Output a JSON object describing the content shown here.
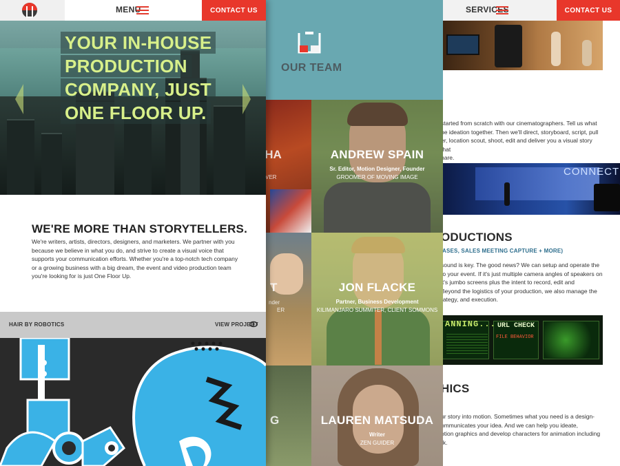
{
  "left": {
    "menu_label": "MENU",
    "contact_label": "CONTACT US",
    "hero_lines": [
      "YOUR IN-HOUSE",
      "PRODUCTION",
      "COMPANY, JUST",
      "ONE FLOOR UP."
    ],
    "about_title": "WE'RE MORE THAN STORYTELLERS.",
    "about_text": "We're writers, artists, directors, designers, and marketers. We partner with you because we believe in what you do, and strive to create a visual voice that supports your communication efforts. Whether you're a top-notch tech company or a growing business with a big dream, the event and video production team you're looking for is just One Floor Up.",
    "project_title": "HAIR BY ROBOTICS",
    "view_project": "VIEW PROJECT"
  },
  "middle": {
    "section_title": "OUR TEAM",
    "left_partial": [
      "RHA",
      "VER",
      "T",
      "nder",
      "ER",
      "G"
    ],
    "members": [
      {
        "name": "ANDREW SPAIN",
        "role": "Sr. Editor, Motion Designer, Founder",
        "tag": "GROOMER OF MOVING IMAGE"
      },
      {
        "name": "JON FLACKE",
        "role": "Partner, Business Development",
        "tag": "KILIMANJARO SUMMITER, CLIENT SOMMONS"
      },
      {
        "name": "LAUREN MATSUDA",
        "role": "Writer",
        "tag": "ZEN GUIDER"
      }
    ]
  },
  "right": {
    "services_label": "SERVICES",
    "contact_label": "CONTACT US",
    "para1": [
      " started from scratch with our cinematographers. Tell us what",
      "he ideation together. Then we'll direct, storyboard, script, pull",
      "er, location scout, shoot, edit and deliver you a visual story that",
      "hare."
    ],
    "connect_text": "CONNECT",
    "heading_productions": "ODUCTIONS",
    "sub_productions": "ASES, SALES MEETING CAPTURE + MORE)",
    "para2": [
      " sound is key. The good news? We can setup and operate the",
      " to your event. If it's just multiple camera angles of speakers on",
      " it's jumbo screens plus the intent to record, edit and",
      "Beyond the logistics of your production, we also manage the",
      "rategy, and execution."
    ],
    "planning_text": "ANNING...",
    "url_check": "URL CHECK",
    "file_behavior": "FILE BEHAVIOR",
    "heading_graphics": "HICS",
    "para3": [
      "ur story into motion. Sometimes what you need is a design-",
      "ommunicates your idea. And we can help you ideate,",
      "otion graphics and develop characters for animation including",
      "rk."
    ]
  },
  "colors": {
    "accent_red": "#e8372b",
    "team_teal": "#69a8b1",
    "hero_text": "#d8f08a"
  }
}
